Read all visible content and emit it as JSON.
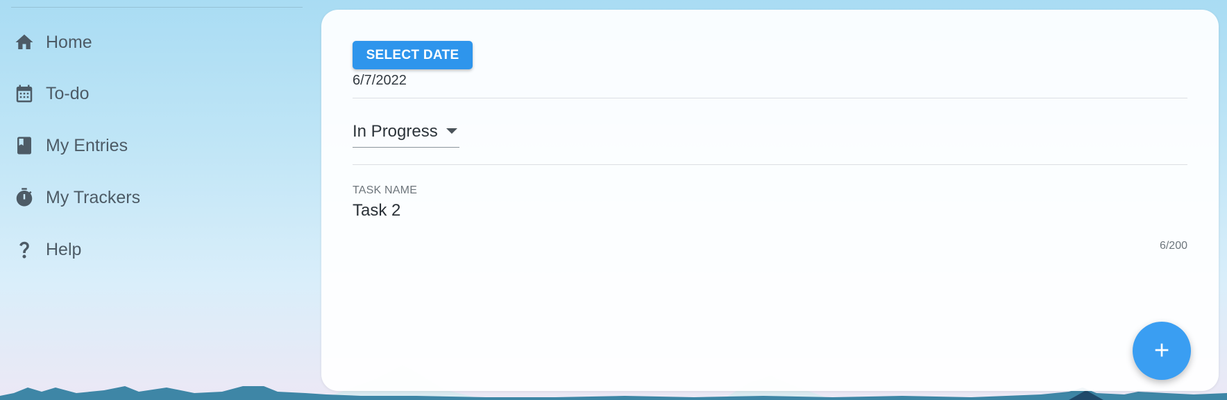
{
  "sidebar": {
    "items": [
      {
        "label": "Home",
        "icon": "home-icon"
      },
      {
        "label": "To-do",
        "icon": "calendar-icon"
      },
      {
        "label": "My Entries",
        "icon": "book-icon"
      },
      {
        "label": "My Trackers",
        "icon": "timer-icon"
      },
      {
        "label": "Help",
        "icon": "help-icon"
      }
    ]
  },
  "form": {
    "select_date_label": "SELECT DATE",
    "date_value": "6/7/2022",
    "status_value": "In Progress",
    "task_name_label": "TASK NAME",
    "task_name_value": "Task 2",
    "char_count": "6/200"
  },
  "fab": {
    "icon": "plus-icon"
  },
  "colors": {
    "primary": "#2e95ec",
    "fab": "#3a9ef2",
    "nav_icon": "#4d5b66"
  }
}
